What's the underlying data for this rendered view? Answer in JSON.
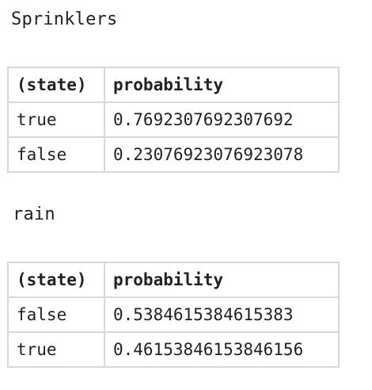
{
  "sections": [
    {
      "title": "Sprinklers",
      "headers": [
        "(state)",
        "probability"
      ],
      "rows": [
        {
          "state": "true",
          "probability": "0.7692307692307692"
        },
        {
          "state": "false",
          "probability": "0.23076923076923078"
        }
      ]
    },
    {
      "title": "rain",
      "headers": [
        "(state)",
        "probability"
      ],
      "rows": [
        {
          "state": "false",
          "probability": "0.5384615384615383"
        },
        {
          "state": "true",
          "probability": "0.46153846153846156"
        }
      ]
    }
  ],
  "colors": {
    "text": "#222222",
    "border": "#d9d9d9",
    "background": "#ffffff"
  }
}
